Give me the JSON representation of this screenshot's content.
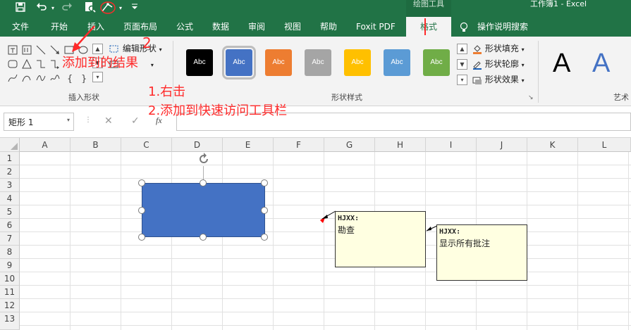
{
  "title_bar": {
    "contextual_group": "绘图工具",
    "window_title": "工作簿1  -  Excel"
  },
  "quick_access": {
    "icons": [
      "save-icon",
      "undo-icon",
      "redo-icon",
      "print-preview-icon",
      "edit-shape-icon",
      "customize-dropdown-icon"
    ]
  },
  "tabs": [
    {
      "label": "文件"
    },
    {
      "label": "开始"
    },
    {
      "label": "插入"
    },
    {
      "label": "页面布局"
    },
    {
      "label": "公式"
    },
    {
      "label": "数据"
    },
    {
      "label": "审阅"
    },
    {
      "label": "视图"
    },
    {
      "label": "帮助"
    },
    {
      "label": "Foxit PDF"
    },
    {
      "label": "格式"
    }
  ],
  "tell_me": "操作说明搜索",
  "ribbon": {
    "insert_shapes": {
      "label": "插入形状",
      "edit_shape": "编辑形状",
      "shape_icons": [
        "text-box-icon",
        "vertical-text-box-icon",
        "line-icon",
        "arrow-line-icon",
        "rectangle-icon",
        "oval-icon",
        "rounded-rectangle-icon",
        "triangle-icon",
        "elbow-connector-icon",
        "elbow-arrow-icon",
        "curve-connector-icon",
        "curved-arrow-icon",
        "scribble-icon",
        "freeform-icon",
        "s-curve-icon",
        "left-brace-icon",
        "right-brace-icon",
        "more-shapes-icon"
      ]
    },
    "shape_styles": {
      "label": "形状样式",
      "swatches": [
        {
          "text": "Abc",
          "color": "#000000"
        },
        {
          "text": "Abc",
          "color": "#4472c4"
        },
        {
          "text": "Abc",
          "color": "#ed7d31"
        },
        {
          "text": "Abc",
          "color": "#a5a5a5"
        },
        {
          "text": "Abc",
          "color": "#ffc000"
        },
        {
          "text": "Abc",
          "color": "#5b9bd5"
        },
        {
          "text": "Abc",
          "color": "#70ad47"
        }
      ],
      "shape_fill": "形状填充",
      "shape_outline": "形状轮廓",
      "shape_effects": "形状效果"
    },
    "wordart": {
      "label": "艺术",
      "sample": "A"
    }
  },
  "formula_bar": {
    "name_box": "矩形 1",
    "cancel": "✕",
    "enter": "✓",
    "fx": "fx",
    "value": ""
  },
  "sheet": {
    "columns": [
      "A",
      "B",
      "C",
      "D",
      "E",
      "F",
      "G",
      "H",
      "I",
      "J",
      "K",
      "L"
    ],
    "rows": [
      "1",
      "2",
      "3",
      "4",
      "5",
      "6",
      "7",
      "8",
      "9",
      "10",
      "11",
      "12",
      "13"
    ],
    "shape_fill": "#4472c4",
    "comments": [
      {
        "author": "HJXX:",
        "text": "勘查"
      },
      {
        "author": "HJXX:",
        "text": "显示所有批注"
      }
    ]
  },
  "annotations": {
    "step_number": "2",
    "result_note": "添加到的结果",
    "step1": "1.右击",
    "step2": "2.添加到快速访问工具栏",
    "color": "#ff2a2a"
  }
}
